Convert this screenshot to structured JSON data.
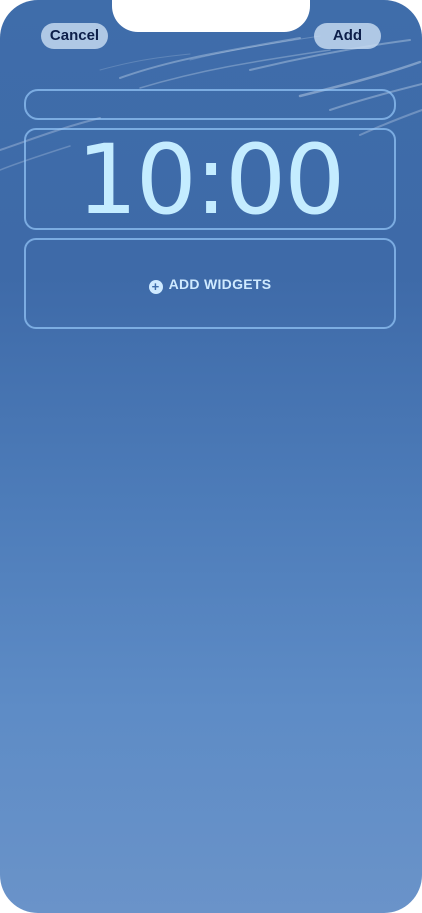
{
  "header": {
    "cancel_label": "Cancel",
    "add_label": "Add"
  },
  "lock_screen": {
    "time": "10:00",
    "add_widgets_label": "ADD WIDGETS",
    "add_widgets_icon": "plus-circle-icon"
  },
  "colors": {
    "wallpaper_top": "#3f6daa",
    "wallpaper_bottom": "#6a93c9",
    "clock": "#c4ecff",
    "button_bg": "#c8dcf2",
    "button_text": "#0d1f4a"
  }
}
